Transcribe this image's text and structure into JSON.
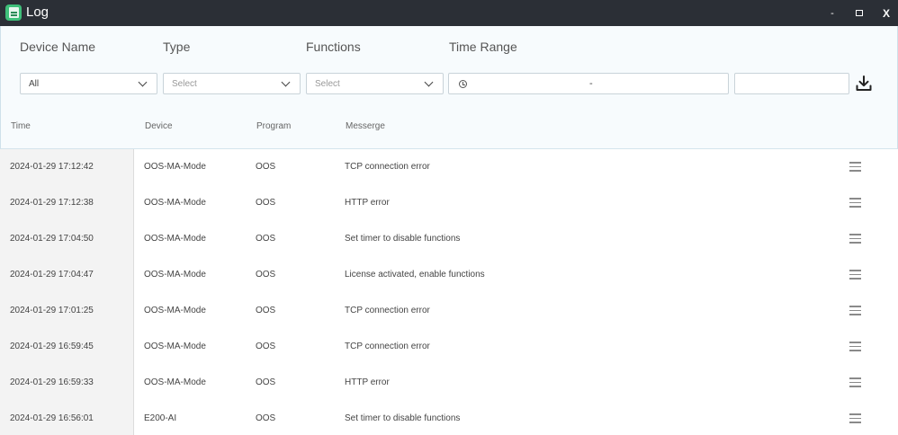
{
  "window": {
    "title": "Log",
    "minimize": "-",
    "close": "X"
  },
  "filters": {
    "device_name_label": "Device Name",
    "type_label": "Type",
    "functions_label": "Functions",
    "time_range_label": "Time Range",
    "device_value": "All",
    "type_placeholder": "Select",
    "functions_placeholder": "Select",
    "time_range_separator": "-"
  },
  "table": {
    "headers": {
      "time": "Time",
      "device": "Device",
      "program": "Program",
      "message": "Messerge"
    },
    "rows": [
      {
        "time": "2024-01-29 17:12:42",
        "device": "OOS-MA-Mode",
        "program": "OOS",
        "message": "TCP connection error"
      },
      {
        "time": "2024-01-29 17:12:38",
        "device": "OOS-MA-Mode",
        "program": "OOS",
        "message": "HTTP error"
      },
      {
        "time": "2024-01-29 17:04:50",
        "device": "OOS-MA-Mode",
        "program": "OOS",
        "message": "Set timer to disable functions"
      },
      {
        "time": "2024-01-29 17:04:47",
        "device": "OOS-MA-Mode",
        "program": "OOS",
        "message": "License activated, enable functions"
      },
      {
        "time": "2024-01-29 17:01:25",
        "device": "OOS-MA-Mode",
        "program": "OOS",
        "message": "TCP connection error"
      },
      {
        "time": "2024-01-29 16:59:45",
        "device": "OOS-MA-Mode",
        "program": "OOS",
        "message": "TCP connection error"
      },
      {
        "time": "2024-01-29 16:59:33",
        "device": "OOS-MA-Mode",
        "program": "OOS",
        "message": "HTTP error"
      },
      {
        "time": "2024-01-29 16:56:01",
        "device": "E200-AI",
        "program": "OOS",
        "message": "Set timer to disable functions"
      }
    ]
  },
  "colors": {
    "titlebar": "#2b2f36",
    "app_icon": "#3fbf7a",
    "panel_bg": "#f7fbfd"
  },
  "icons": [
    "app-icon",
    "chevron-down-icon",
    "clock-icon",
    "download-icon",
    "menu-icon"
  ]
}
